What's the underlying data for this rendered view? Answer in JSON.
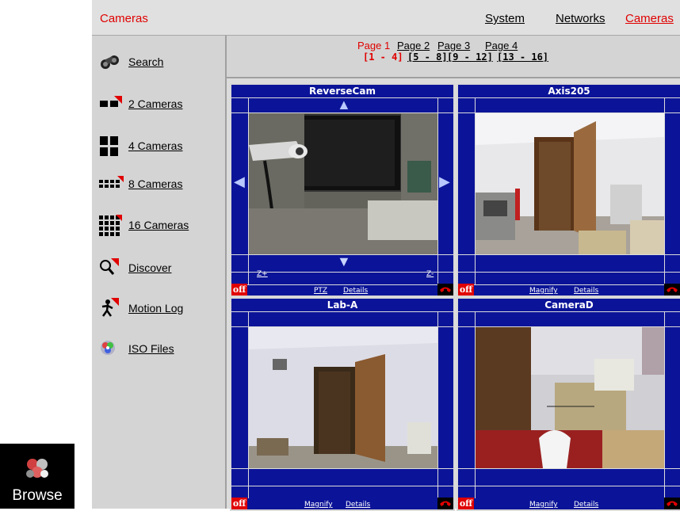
{
  "dock": {
    "label": "Browse"
  },
  "topbar": {
    "title": "Cameras",
    "nav": [
      "System",
      "Networks",
      "Cameras"
    ]
  },
  "sidebar": {
    "items": [
      {
        "label": "Search",
        "icon": "binoculars-icon"
      },
      {
        "label": "2 Cameras",
        "icon": "two-cameras-layout-icon"
      },
      {
        "label": "4 Cameras",
        "icon": "four-cameras-layout-icon"
      },
      {
        "label": "8 Cameras",
        "icon": "eight-cameras-layout-icon"
      },
      {
        "label": "16 Cameras",
        "icon": "sixteen-cameras-layout-icon"
      },
      {
        "label": "Discover",
        "icon": "magnifier-icon"
      },
      {
        "label": "Motion Log",
        "icon": "running-man-icon"
      },
      {
        "label": "ISO Files",
        "icon": "disc-icon"
      }
    ]
  },
  "pages": [
    {
      "label": "Page 1",
      "range": "[1 - 4]"
    },
    {
      "label": "Page 2",
      "range": "[5 - 8]"
    },
    {
      "label": "Page 3",
      "range": "[9 - 12]"
    },
    {
      "label": "Page 4",
      "range": "[13 - 16]"
    }
  ],
  "cameras": [
    {
      "name": "ReverseCam",
      "off": "off",
      "link1": "PTZ",
      "link2": "Details",
      "zoom_in": "Z+",
      "zoom_out": "Z-"
    },
    {
      "name": "Axis205",
      "off": "off",
      "link1": "Magnify",
      "link2": "Details"
    },
    {
      "name": "Lab-A",
      "off": "off",
      "link1": "Magnify",
      "link2": "Details"
    },
    {
      "name": "CameraD",
      "off": "off",
      "link1": "Magnify",
      "link2": "Details"
    }
  ],
  "colors": {
    "frame": "#0b1498",
    "accent_red": "#e00000",
    "panel_gray": "#d4d4d4"
  }
}
